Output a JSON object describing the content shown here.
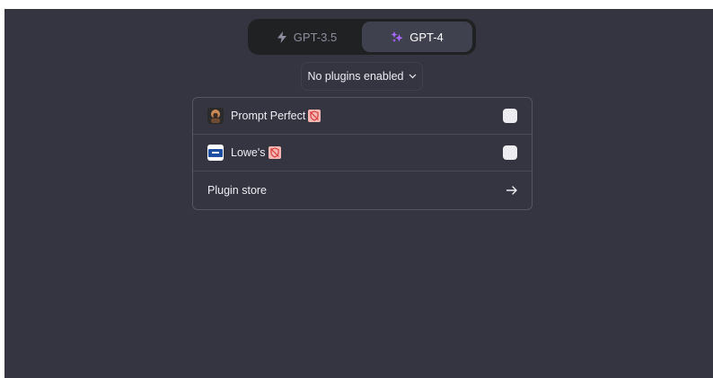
{
  "models": {
    "gpt35": {
      "label": "GPT-3.5",
      "icon": "lightning-icon"
    },
    "gpt4": {
      "label": "GPT-4",
      "icon": "sparkle-icon",
      "active": true
    }
  },
  "plugins_dropdown": {
    "label": "No plugins enabled",
    "icon": "chevron-down-icon"
  },
  "plugins": [
    {
      "name": "Prompt Perfect",
      "icon": "prompt-perfect-logo",
      "badge": "unverified-icon",
      "checked": false
    },
    {
      "name": "Lowe's",
      "icon": "lowes-logo",
      "badge": "unverified-icon",
      "checked": false
    }
  ],
  "plugin_store": {
    "label": "Plugin store",
    "icon": "arrow-right-icon"
  },
  "colors": {
    "background": "#343541",
    "switch_bg": "#202123",
    "active_tab": "#40414f",
    "gpt4_accent": "#ab68ff",
    "unverified_badge": "#f7b7b3"
  }
}
